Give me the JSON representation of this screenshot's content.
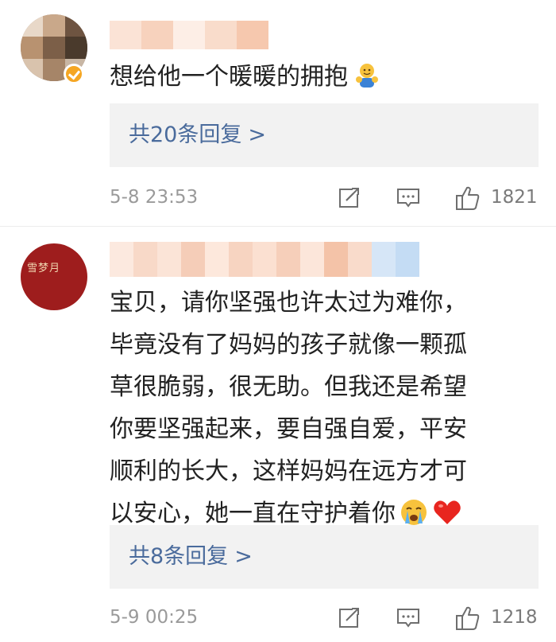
{
  "comments": [
    {
      "text": "想给他一个暖暖的拥抱",
      "emojis": [
        "hug-emoji"
      ],
      "verified": true,
      "replies_label": "共20条回复",
      "replies_arrow": ">",
      "timestamp": "5-8 23:53",
      "like_count": "1821",
      "avatar_color": "#9b7d63",
      "badge_color": "#f5a623"
    },
    {
      "text_lines": [
        "宝贝，请你坚强也许太过为难你，",
        "毕竟没有了妈妈的孩子就像一颗孤",
        "草很脆弱，很无助。但我还是希望",
        "你要坚强起来，要自强自爱，平安",
        "顺利的长大，这样妈妈在远方才可",
        "以安心，她一直在守护着你"
      ],
      "emojis": [
        "crying-emoji",
        "heart-emoji"
      ],
      "avatar_text": "雪梦月",
      "replies_label": "共8条回复",
      "replies_arrow": ">",
      "timestamp": "5-9 00:25",
      "like_count": "1218",
      "avatar_color": "#9e1d1d"
    }
  ],
  "icons": [
    "share-icon",
    "comment-icon",
    "thumbs-up-icon"
  ],
  "colors": {
    "link": "#4a6b9c",
    "meta": "#9a9a9a",
    "reply_bg": "#f2f2f2",
    "text": "#222222"
  }
}
